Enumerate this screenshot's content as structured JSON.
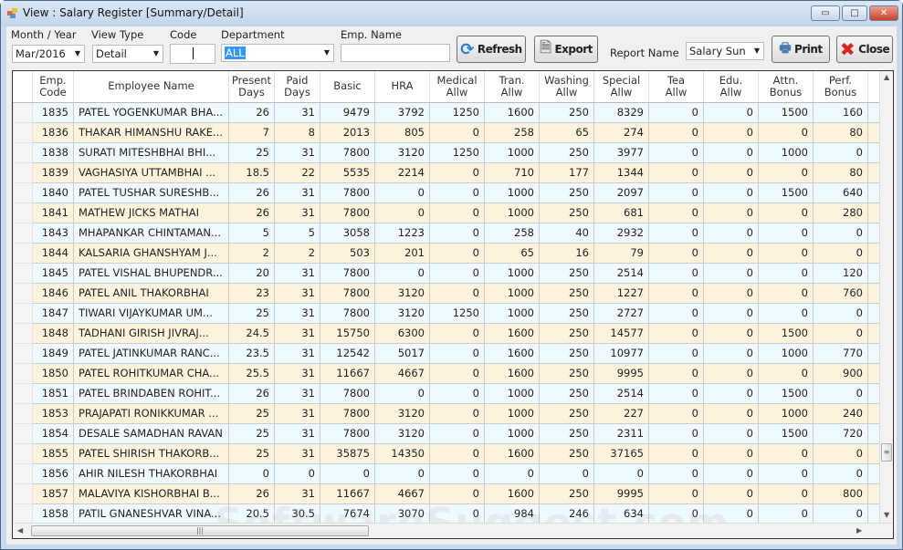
{
  "window": {
    "title": "View : Salary Register [Summary/Detail]",
    "minimize": "▭",
    "maximize": "□",
    "close": "✕"
  },
  "filters": {
    "month_label": "Month / Year",
    "month_value": "Mar/2016",
    "viewtype_label": "View Type",
    "viewtype_value": "Detail",
    "code_label": "Code",
    "code_value": "",
    "department_label": "Department",
    "department_value": "ALL",
    "empname_label": "Emp. Name",
    "empname_value": "",
    "report_label": "Report Name",
    "report_value": "Salary Sun"
  },
  "toolbar": {
    "refresh": "Refresh",
    "export": "Export",
    "print": "Print",
    "close": "Close"
  },
  "colors": {
    "row_odd": "#effaff",
    "row_even": "#fdf3dc",
    "close_x": "#d9261c",
    "refresh": "#2a7fd0"
  },
  "columns": [
    [
      "Emp.",
      "Code"
    ],
    [
      "",
      "Employee Name"
    ],
    [
      "Present",
      "Days"
    ],
    [
      "Paid",
      "Days"
    ],
    [
      "",
      "Basic"
    ],
    [
      "",
      "HRA"
    ],
    [
      "Medical",
      "Allw"
    ],
    [
      "Tran.",
      "Allw"
    ],
    [
      "Washing",
      "Allw"
    ],
    [
      "Special",
      "Allw"
    ],
    [
      "Tea",
      "Allw"
    ],
    [
      "Edu.",
      "Allw"
    ],
    [
      "Attn.",
      "Bonus"
    ],
    [
      "Perf.",
      "Bonus"
    ]
  ],
  "rows": [
    [
      "1835",
      "PATEL YOGENKUMAR BHA...",
      "26",
      "31",
      "9479",
      "3792",
      "1250",
      "1600",
      "250",
      "8329",
      "0",
      "0",
      "1500",
      "160"
    ],
    [
      "1836",
      "THAKAR HIMANSHU RAKE...",
      "7",
      "8",
      "2013",
      "805",
      "0",
      "258",
      "65",
      "274",
      "0",
      "0",
      "0",
      "80"
    ],
    [
      "1838",
      "SURATI MITESHBHAI BHI...",
      "25",
      "31",
      "7800",
      "3120",
      "1250",
      "1000",
      "250",
      "3977",
      "0",
      "0",
      "1000",
      "0"
    ],
    [
      "1839",
      "VAGHASIYA UTTAMBHAI ...",
      "18.5",
      "22",
      "5535",
      "2214",
      "0",
      "710",
      "177",
      "1344",
      "0",
      "0",
      "0",
      "80"
    ],
    [
      "1840",
      "PATEL TUSHAR SURESHB...",
      "26",
      "31",
      "7800",
      "0",
      "0",
      "1000",
      "250",
      "2097",
      "0",
      "0",
      "1500",
      "640"
    ],
    [
      "1841",
      "MATHEW JICKS MATHAI",
      "26",
      "31",
      "7800",
      "0",
      "0",
      "1000",
      "250",
      "681",
      "0",
      "0",
      "0",
      "280"
    ],
    [
      "1843",
      "MHAPANKAR CHINTAMAN...",
      "5",
      "5",
      "3058",
      "1223",
      "0",
      "258",
      "40",
      "2932",
      "0",
      "0",
      "0",
      "0"
    ],
    [
      "1844",
      "KALSARIA GHANSHYAM J...",
      "2",
      "2",
      "503",
      "201",
      "0",
      "65",
      "16",
      "79",
      "0",
      "0",
      "0",
      "0"
    ],
    [
      "1845",
      "PATEL VISHAL BHUPENDR...",
      "20",
      "31",
      "7800",
      "0",
      "0",
      "1000",
      "250",
      "2514",
      "0",
      "0",
      "0",
      "120"
    ],
    [
      "1846",
      "PATEL ANIL THAKORBHAI",
      "23",
      "31",
      "7800",
      "3120",
      "0",
      "1000",
      "250",
      "1227",
      "0",
      "0",
      "0",
      "760"
    ],
    [
      "1847",
      "TIWARI VIJAYKUMAR UM...",
      "25",
      "31",
      "7800",
      "3120",
      "1250",
      "1000",
      "250",
      "2727",
      "0",
      "0",
      "0",
      "0"
    ],
    [
      "1848",
      "TADHANI GIRISH JIVRAJ...",
      "24.5",
      "31",
      "15750",
      "6300",
      "0",
      "1600",
      "250",
      "14577",
      "0",
      "0",
      "1500",
      "0"
    ],
    [
      "1849",
      "PATEL JATINKUMAR RANC...",
      "23.5",
      "31",
      "12542",
      "5017",
      "0",
      "1600",
      "250",
      "10977",
      "0",
      "0",
      "1000",
      "770"
    ],
    [
      "1850",
      "PATEL ROHITKUMAR CHA...",
      "25.5",
      "31",
      "11667",
      "4667",
      "0",
      "1600",
      "250",
      "9995",
      "0",
      "0",
      "0",
      "900"
    ],
    [
      "1851",
      "PATEL BRINDABEN ROHIT...",
      "26",
      "31",
      "7800",
      "0",
      "0",
      "1000",
      "250",
      "2514",
      "0",
      "0",
      "1500",
      "0"
    ],
    [
      "1853",
      "PRAJAPATI RONIKKUMAR ...",
      "25",
      "31",
      "7800",
      "3120",
      "0",
      "1000",
      "250",
      "227",
      "0",
      "0",
      "1000",
      "240"
    ],
    [
      "1854",
      "DESALE SAMADHAN RAVAN",
      "25",
      "31",
      "7800",
      "3120",
      "0",
      "1000",
      "250",
      "2311",
      "0",
      "0",
      "1500",
      "720"
    ],
    [
      "1855",
      "PATEL SHIRISH THAKORB...",
      "25",
      "31",
      "35875",
      "14350",
      "0",
      "1600",
      "250",
      "37165",
      "0",
      "0",
      "0",
      "0"
    ],
    [
      "1856",
      "AHIR NILESH THAKORBHAI",
      "0",
      "0",
      "0",
      "0",
      "0",
      "0",
      "0",
      "0",
      "0",
      "0",
      "0",
      "0"
    ],
    [
      "1857",
      "MALAVIYA KISHORBHAI B...",
      "26",
      "31",
      "11667",
      "4667",
      "0",
      "1600",
      "250",
      "9995",
      "0",
      "0",
      "0",
      "800"
    ],
    [
      "1858",
      "PATIL GNANESHVAR VINA...",
      "20.5",
      "30.5",
      "7674",
      "3070",
      "0",
      "984",
      "246",
      "634",
      "0",
      "0",
      "0",
      "0"
    ]
  ],
  "watermark": "SoftwareSuggest.com"
}
